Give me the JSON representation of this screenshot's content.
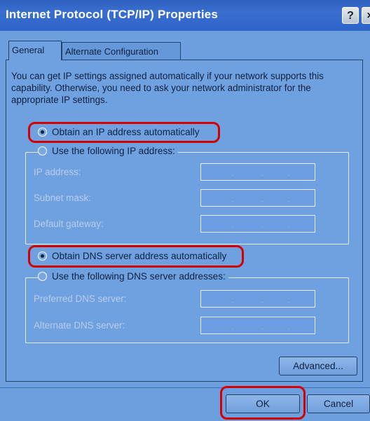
{
  "window": {
    "title": "Internet Protocol (TCP/IP) Properties",
    "help_label": "?",
    "close_label": "×"
  },
  "tabs": [
    {
      "label": "General",
      "selected": true
    },
    {
      "label": "Alternate Configuration",
      "selected": false
    }
  ],
  "intro_text": "You can get IP settings assigned automatically if your network supports this capability. Otherwise, you need to ask your network administrator for the appropriate IP settings.",
  "ip_section": {
    "auto_option": {
      "label": "Obtain an IP address automatically",
      "checked": true
    },
    "manual_option": {
      "label": "Use the following IP address:",
      "checked": false
    },
    "fields": [
      {
        "label": "IP address:",
        "value": ""
      },
      {
        "label": "Subnet mask:",
        "value": ""
      },
      {
        "label": "Default gateway:",
        "value": ""
      }
    ]
  },
  "dns_section": {
    "auto_option": {
      "label": "Obtain DNS server address automatically",
      "checked": true
    },
    "manual_option": {
      "label": "Use the following DNS server addresses:",
      "checked": false
    },
    "fields": [
      {
        "label": "Preferred DNS server:",
        "value": ""
      },
      {
        "label": "Alternate DNS server:",
        "value": ""
      }
    ]
  },
  "buttons": {
    "advanced": "Advanced...",
    "ok": "OK",
    "cancel": "Cancel"
  },
  "colors": {
    "highlight": "#d40000",
    "titlebar": "#2d5fc0",
    "panel": "#6fa1e1"
  }
}
